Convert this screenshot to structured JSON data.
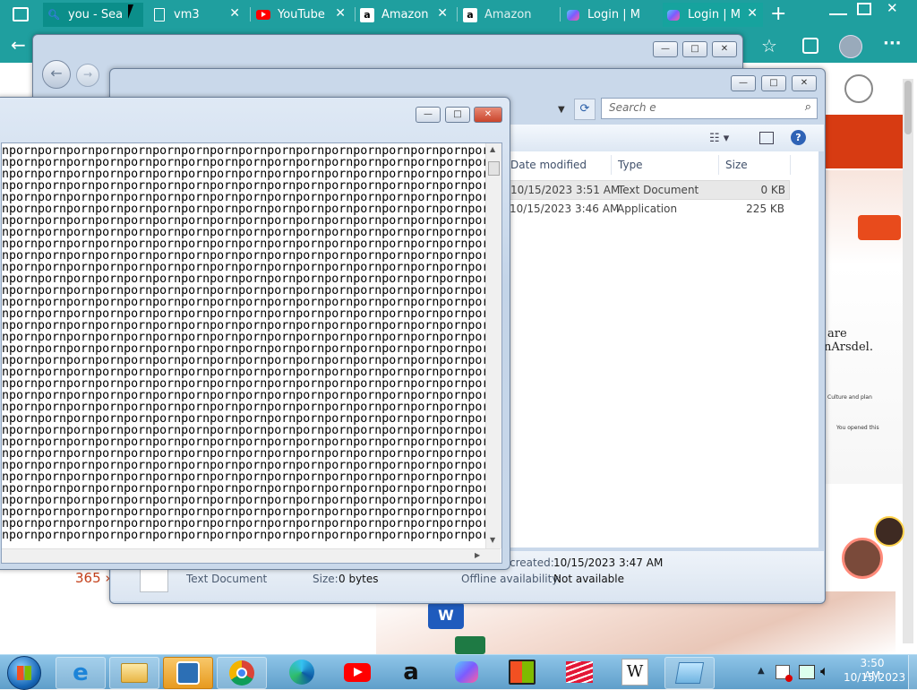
{
  "browser": {
    "tabs": [
      {
        "title": "you - Sea",
        "icon": "search-icon"
      },
      {
        "title": "vm3",
        "icon": "document-icon"
      },
      {
        "title": "YouTube",
        "icon": "youtube-icon"
      },
      {
        "title": "Amazon",
        "icon": "amazon-icon"
      },
      {
        "title": "Amazon",
        "icon": "amazon-icon"
      },
      {
        "title": "Login | M",
        "icon": "copilot-icon"
      },
      {
        "title": "Login | M",
        "icon": "copilot-icon"
      }
    ],
    "new_tab_label": "+",
    "close_glyph": "✕",
    "menu_glyph": "···"
  },
  "webpage": {
    "promo_text": "365 ›",
    "phone_lines": [
      "are",
      "nArsdel."
    ],
    "phone_items": [
      "Culture and plan",
      "You opened this"
    ]
  },
  "explorer": {
    "search_placeholder": "Search e",
    "columns": {
      "date": "Date modified",
      "type": "Type",
      "size": "Size"
    },
    "files": [
      {
        "date": "10/15/2023 3:51 AM",
        "type": "Text Document",
        "size": "0 KB"
      },
      {
        "date": "10/15/2023 3:46 AM",
        "type": "Application",
        "size": "225 KB"
      }
    ],
    "details": {
      "created_label": "created:",
      "created_value": "10/15/2023 3:47 AM",
      "type": "Text Document",
      "size_label": "Size:",
      "size_value": "0 bytes",
      "offline_label": "Offline availability:",
      "offline_value": "Not available"
    }
  },
  "notepad": {
    "pattern": "npor",
    "line_prefix": "",
    "line_count": 34
  },
  "taskbar": {
    "time": "3:50 AM",
    "date": "10/15/2023",
    "wikipedia_glyph": "W"
  },
  "colors": {
    "browser_teal": "#1f9f9f",
    "explorer_frame": "#c9d8ea",
    "notepad_close": "#c9452c"
  }
}
